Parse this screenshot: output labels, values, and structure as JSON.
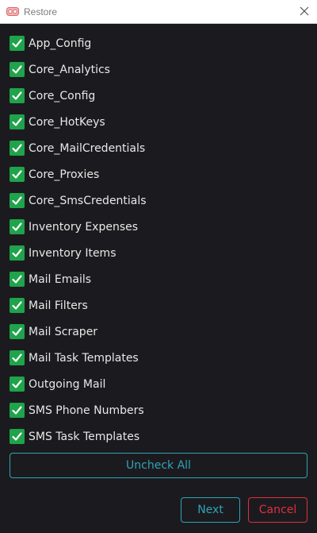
{
  "window": {
    "title": "Restore",
    "app_icon": "tape-reel-icon",
    "close_icon": "close-icon"
  },
  "colors": {
    "checkbox": "#1fa34b",
    "accent": "#2fa3b7",
    "danger": "#e0303c",
    "background": "#1b1b1f"
  },
  "items": [
    {
      "label": "App_Config",
      "checked": true
    },
    {
      "label": "Core_Analytics",
      "checked": true
    },
    {
      "label": "Core_Config",
      "checked": true
    },
    {
      "label": "Core_HotKeys",
      "checked": true
    },
    {
      "label": "Core_MailCredentials",
      "checked": true
    },
    {
      "label": "Core_Proxies",
      "checked": true
    },
    {
      "label": "Core_SmsCredentials",
      "checked": true
    },
    {
      "label": "Inventory Expenses",
      "checked": true
    },
    {
      "label": "Inventory Items",
      "checked": true
    },
    {
      "label": "Mail Emails",
      "checked": true
    },
    {
      "label": "Mail Filters",
      "checked": true
    },
    {
      "label": "Mail Scraper",
      "checked": true
    },
    {
      "label": "Mail Task Templates",
      "checked": true
    },
    {
      "label": "Outgoing Mail",
      "checked": true
    },
    {
      "label": "SMS Phone Numbers",
      "checked": true
    },
    {
      "label": "SMS Task Templates",
      "checked": true
    }
  ],
  "actions": {
    "uncheck_all": "Uncheck All",
    "next": "Next",
    "cancel": "Cancel"
  }
}
